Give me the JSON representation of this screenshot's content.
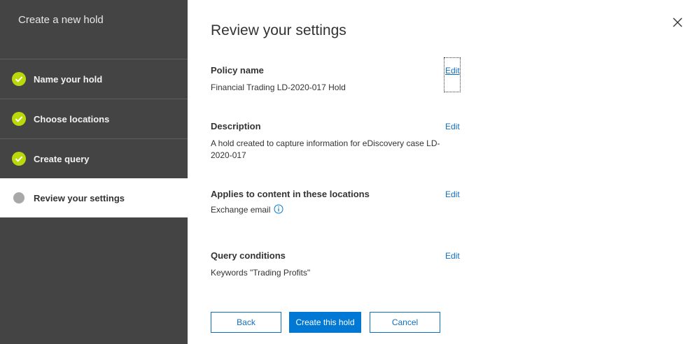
{
  "wizard": {
    "title": "Create a new hold",
    "steps": [
      {
        "label": "Name your hold",
        "status": "completed",
        "icon": "check-circle-icon"
      },
      {
        "label": "Choose locations",
        "status": "completed",
        "icon": "check-circle-icon"
      },
      {
        "label": "Create query",
        "status": "completed",
        "icon": "check-circle-icon"
      },
      {
        "label": "Review your settings",
        "status": "current",
        "icon": "dot-icon"
      }
    ]
  },
  "main": {
    "title": "Review your settings",
    "sections": [
      {
        "heading": "Policy name",
        "value": "Financial Trading LD-2020-017 Hold",
        "edit_label": "Edit"
      },
      {
        "heading": "Description",
        "value": "A hold created to capture information for eDiscovery case LD-2020-017",
        "edit_label": "Edit"
      },
      {
        "heading": "Applies to content in these locations",
        "value": "Exchange email",
        "edit_label": "Edit"
      },
      {
        "heading": "Query conditions",
        "value": "Keywords \"Trading Profits\"",
        "edit_label": "Edit"
      }
    ]
  },
  "buttons": {
    "back": "Back",
    "create": "Create this hold",
    "cancel": "Cancel"
  },
  "colors": {
    "sidebar_bg": "#444444",
    "check_green": "#bad80a",
    "accent_blue": "#0078d4",
    "link_blue": "#106ebe"
  }
}
